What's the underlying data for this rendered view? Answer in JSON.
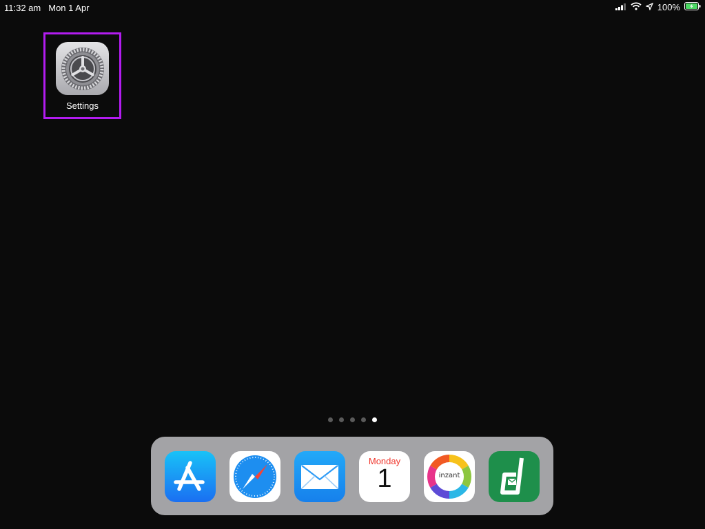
{
  "status_bar": {
    "time": "11:32 am",
    "date": "Mon 1 Apr",
    "battery_percent": "100%",
    "icons": [
      "signal-icon",
      "wifi-icon",
      "location-arrow-icon",
      "battery-charging-icon"
    ]
  },
  "home": {
    "apps": [
      {
        "label": "Settings",
        "icon": "settings-gear-icon",
        "highlighted": true,
        "highlight_color": "#b21cf0"
      }
    ]
  },
  "page_indicator": {
    "count": 5,
    "active_index": 4
  },
  "dock": {
    "apps": [
      {
        "name": "App Store",
        "icon": "app-store-icon"
      },
      {
        "name": "Safari",
        "icon": "safari-compass-icon"
      },
      {
        "name": "Mail",
        "icon": "mail-envelope-icon"
      },
      {
        "name": "Calendar",
        "icon": "calendar-icon",
        "day": "Monday",
        "date": "1"
      },
      {
        "name": "inzant",
        "icon": "inzant-icon",
        "text": "inzant"
      },
      {
        "name": "green-d-app",
        "icon": "green-d-mail-icon"
      }
    ]
  },
  "colors": {
    "background": "#0b0b0b",
    "highlight": "#b21cf0",
    "dock": "#a3a3a6"
  }
}
